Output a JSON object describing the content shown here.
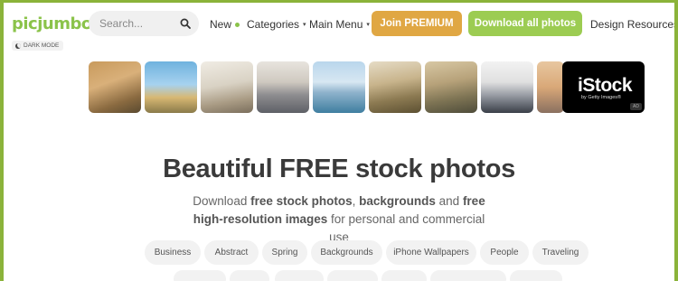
{
  "header": {
    "logo": "picjumbo",
    "dark_mode_label": "DARK MODE",
    "search": {
      "placeholder": "Search...",
      "icon": "search-icon"
    },
    "nav": [
      {
        "label": "New",
        "indicator": "green-dot"
      },
      {
        "label": "Categories",
        "caret": "▾"
      },
      {
        "label": "Main Menu",
        "caret": "▾"
      }
    ],
    "join_premium": "Join PREMIUM",
    "download_all": "Download all photos",
    "design_resources": "Design Resources"
  },
  "photo_strip": {
    "ad": {
      "brand": "iStock",
      "subtitle": "by Getty Images®",
      "badge": "AD"
    }
  },
  "hero": {
    "title": "Beautiful FREE stock photos",
    "subtitle": {
      "p1": "Download ",
      "b1": "free stock photos",
      "p2": ", ",
      "b2": "backgrounds",
      "p3": " and ",
      "b3": "free high-resolution images",
      "p4": " for personal and commercial use"
    }
  },
  "tags": [
    "Business",
    "Abstract",
    "Spring",
    "Backgrounds",
    "iPhone Wallpapers",
    "People",
    "Traveling"
  ],
  "colors": {
    "brand_green": "#8bc34a",
    "premium": "#e0a743",
    "download": "#9ccc52",
    "frame_border": "#8bb33a"
  }
}
